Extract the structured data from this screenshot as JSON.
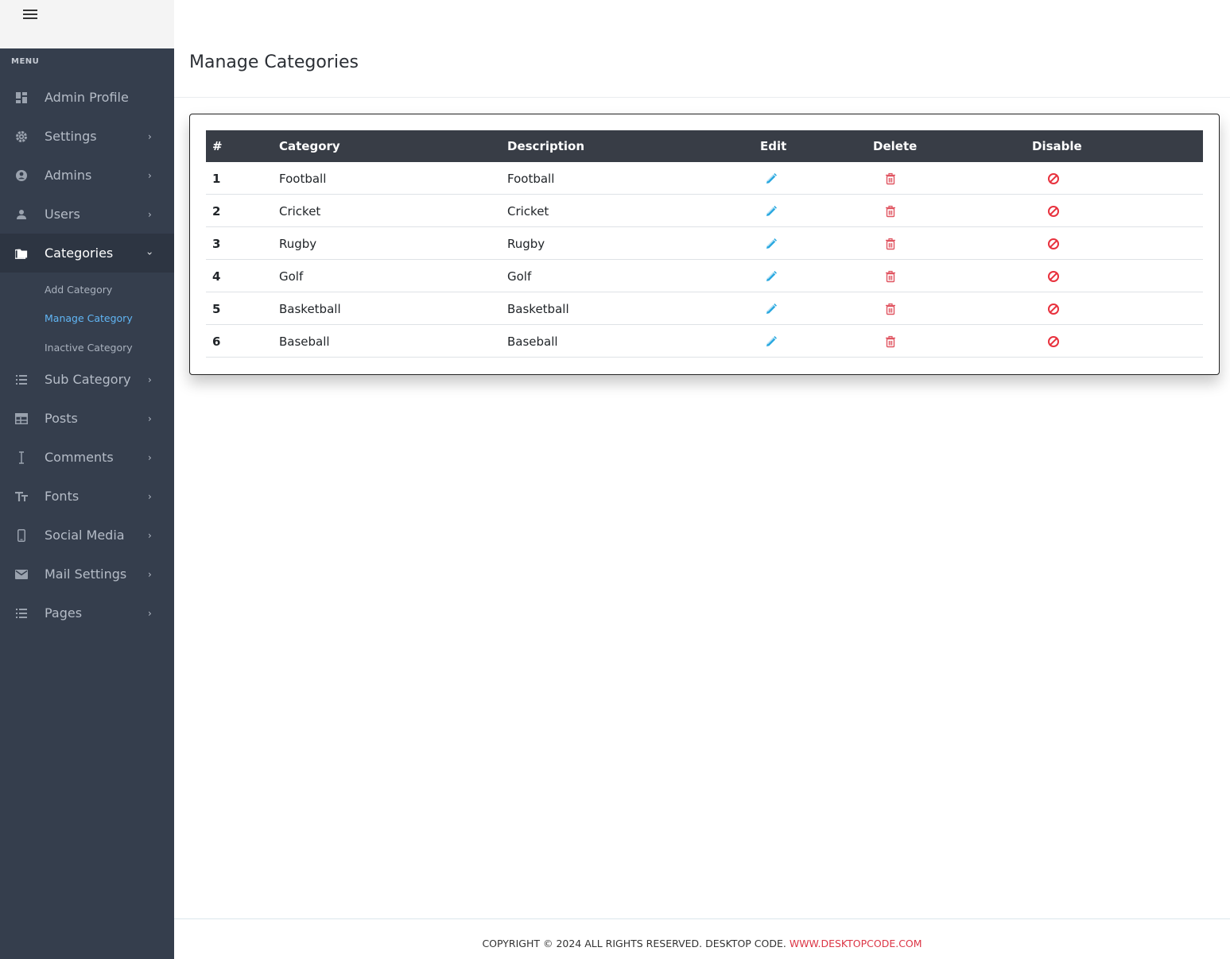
{
  "sidebar": {
    "menu_label": "MENU",
    "items": [
      {
        "label": "Admin Profile",
        "icon": "dashboard-icon",
        "has_children": false
      },
      {
        "label": "Settings",
        "icon": "gear-icon",
        "has_children": true
      },
      {
        "label": "Admins",
        "icon": "account-circle-icon",
        "has_children": true
      },
      {
        "label": "Users",
        "icon": "person-icon",
        "has_children": true
      },
      {
        "label": "Categories",
        "icon": "folder-icon",
        "has_children": true,
        "expanded": true
      },
      {
        "label": "Sub Category",
        "icon": "list-icon",
        "has_children": true
      },
      {
        "label": "Posts",
        "icon": "table-icon",
        "has_children": true
      },
      {
        "label": "Comments",
        "icon": "text-cursor-icon",
        "has_children": true
      },
      {
        "label": "Fonts",
        "icon": "font-size-icon",
        "has_children": true
      },
      {
        "label": "Social Media",
        "icon": "phone-icon",
        "has_children": true
      },
      {
        "label": "Mail Settings",
        "icon": "mail-icon",
        "has_children": true
      },
      {
        "label": "Pages",
        "icon": "list-icon",
        "has_children": true
      }
    ],
    "categories_submenu": [
      {
        "label": "Add Category"
      },
      {
        "label": "Manage Category",
        "current": true
      },
      {
        "label": "Inactive Category"
      }
    ]
  },
  "main": {
    "title": "Manage Categories",
    "table": {
      "columns": [
        "#",
        "Category",
        "Description",
        "Edit",
        "Delete",
        "Disable"
      ],
      "rows": [
        {
          "num": "1",
          "category": "Football",
          "description": "Football"
        },
        {
          "num": "2",
          "category": "Cricket",
          "description": "Cricket"
        },
        {
          "num": "3",
          "category": "Rugby",
          "description": "Rugby"
        },
        {
          "num": "4",
          "category": "Golf",
          "description": "Golf"
        },
        {
          "num": "5",
          "category": "Basketball",
          "description": "Basketball"
        },
        {
          "num": "6",
          "category": "Baseball",
          "description": "Baseball"
        }
      ]
    }
  },
  "footer": {
    "text": "COPYRIGHT © 2024 ALL RIGHTS RESERVED. DESKTOP CODE. ",
    "link": "WWW.DESKTOPCODE.COM"
  },
  "colors": {
    "sidebar_bg": "#353e4d",
    "table_header_bg": "#383d46",
    "edit_icon": "#2aa8e0",
    "delete_icon": "#e05561",
    "disable_icon": "#e8313d",
    "submenu_active": "#61b6f5"
  }
}
